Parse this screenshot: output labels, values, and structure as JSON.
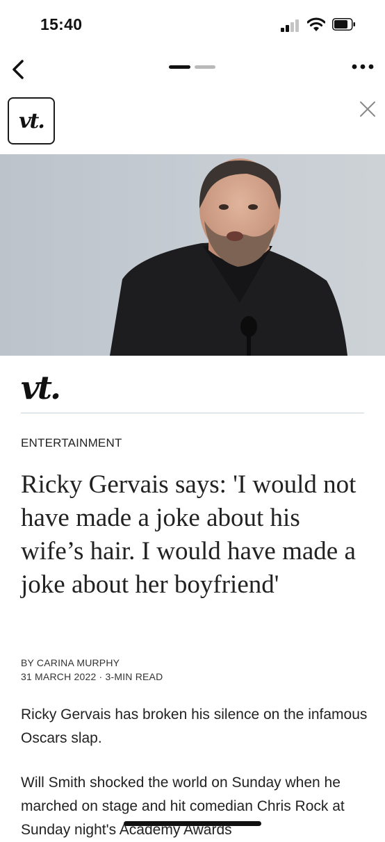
{
  "status_bar": {
    "time": "15:40",
    "icons": [
      "cellular-signal-icon",
      "wifi-icon",
      "battery-icon"
    ]
  },
  "nav": {
    "back_icon": "chevron-left-icon",
    "page_indicator": {
      "pages": 2,
      "current": 1
    },
    "more_icon": "more-horizontal-icon"
  },
  "banner": {
    "logo_text": "vt.",
    "close_icon": "close-icon"
  },
  "hero_image": {
    "subject": "man with grey beard in black shirt speaking into microphone"
  },
  "article": {
    "publication_logo": "vt.",
    "section": "ENTERTAINMENT",
    "headline": "Ricky Gervais says: 'I would not have made a joke about his wife’s hair. I would have made a joke about her boyfriend'",
    "byline": "BY CARINA MURPHY",
    "date": "31 MARCH 2022",
    "separator": "·",
    "read_time": "3-MIN READ",
    "paragraphs": [
      "Ricky Gervais has broken his silence on the infamous Oscars slap.",
      "Will Smith shocked the world on Sunday when he marched on stage and hit comedian Chris Rock at Sunday night's Academy Awards"
    ]
  },
  "colors": {
    "background": "#ffffff",
    "text": "#222222",
    "divider": "#c9d3db",
    "hero_backdrop": "#c3c9d0"
  }
}
